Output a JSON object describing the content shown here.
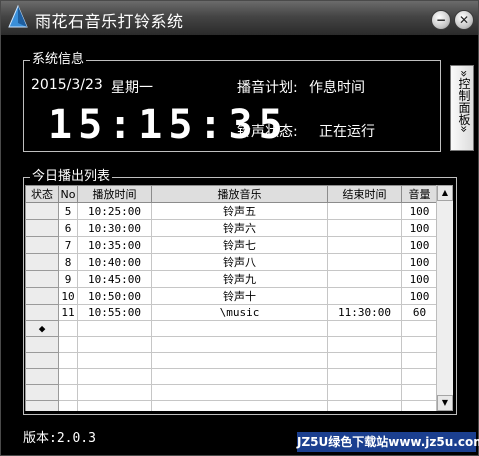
{
  "window": {
    "title": "雨花石音乐打铃系统"
  },
  "titlebar_buttons": {
    "minimize_glyph": "−",
    "close_glyph": "✕"
  },
  "system_info": {
    "group_title": "系统信息",
    "date": "2015/3/23",
    "weekday": "星期一",
    "clock": "15:15:35",
    "schedule_label": "播音计划:",
    "schedule_value": "作息时间",
    "status_label": "铃声状态:",
    "status_value": "正在运行"
  },
  "control_panel_button": "»控制面板»",
  "playlist": {
    "group_title": "今日播出列表",
    "columns": [
      "状态",
      "No",
      "播放时间",
      "播放音乐",
      "结束时间",
      "音量"
    ],
    "rows": [
      {
        "status": "",
        "no": "5",
        "time": "10:25:00",
        "music": "铃声五",
        "end": "",
        "volume": "100"
      },
      {
        "status": "",
        "no": "6",
        "time": "10:30:00",
        "music": "铃声六",
        "end": "",
        "volume": "100"
      },
      {
        "status": "",
        "no": "7",
        "time": "10:35:00",
        "music": "铃声七",
        "end": "",
        "volume": "100"
      },
      {
        "status": "",
        "no": "8",
        "time": "10:40:00",
        "music": "铃声八",
        "end": "",
        "volume": "100"
      },
      {
        "status": "",
        "no": "9",
        "time": "10:45:00",
        "music": "铃声九",
        "end": "",
        "volume": "100"
      },
      {
        "status": "",
        "no": "10",
        "time": "10:50:00",
        "music": "铃声十",
        "end": "",
        "volume": "100"
      },
      {
        "status": "",
        "no": "11",
        "time": "10:55:00",
        "music": "\\music",
        "end": "11:30:00",
        "volume": "60"
      },
      {
        "status": "◆",
        "no": "",
        "time": "",
        "music": "",
        "end": "",
        "volume": ""
      },
      {
        "status": "",
        "no": "",
        "time": "",
        "music": "",
        "end": "",
        "volume": ""
      },
      {
        "status": "",
        "no": "",
        "time": "",
        "music": "",
        "end": "",
        "volume": ""
      },
      {
        "status": "",
        "no": "",
        "time": "",
        "music": "",
        "end": "",
        "volume": ""
      },
      {
        "status": "",
        "no": "",
        "time": "",
        "music": "",
        "end": "",
        "volume": ""
      },
      {
        "status": "",
        "no": "",
        "time": "",
        "music": "",
        "end": "",
        "volume": ""
      }
    ]
  },
  "scrollbar": {
    "up_glyph": "▲",
    "down_glyph": "▼"
  },
  "version": "版本:2.0.3",
  "watermark": "JZ5U绿色下载站www.jz5u.com",
  "colors": {
    "background": "#000000",
    "text": "#ffffff",
    "titlebar": "#454545",
    "grid_header": "#dedede"
  }
}
